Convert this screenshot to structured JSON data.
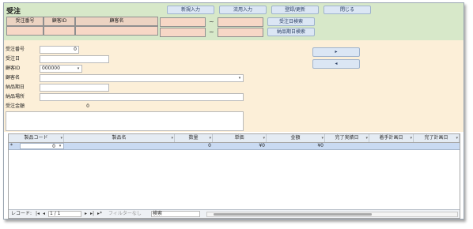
{
  "form": {
    "title": "受注"
  },
  "toolbar": {
    "new_label": "新規入力",
    "copy_label": "流用入力",
    "save_label": "登録/更新",
    "close_label": "閉じる"
  },
  "filter": {
    "headers": [
      "受注番号",
      "顧客ID",
      "顧客名"
    ],
    "tilde": "~",
    "order_date_search_label": "受注日検索",
    "delivery_date_search_label": "納品期日検索"
  },
  "fields": {
    "order_no": {
      "label": "受注番号",
      "value": "0"
    },
    "order_date": {
      "label": "受注日",
      "value": ""
    },
    "customer_id": {
      "label": "顧客ID",
      "value": "000000"
    },
    "customer_name": {
      "label": "顧客名",
      "value": ""
    },
    "delivery_due": {
      "label": "納品期日",
      "value": ""
    },
    "delivery_place": {
      "label": "納品場所",
      "value": ""
    },
    "order_amount": {
      "label": "受注金額",
      "value": "0"
    },
    "remarks": {
      "label": "備考",
      "value": ""
    }
  },
  "nav": {
    "next_label": "▸",
    "prev_label": "◂"
  },
  "subform": {
    "columns": [
      "製品コード",
      "製品名",
      "数量",
      "単価",
      "金額",
      "完了実績日",
      "着手計画日",
      "完了計画日"
    ],
    "row": {
      "marker": "*",
      "product_code": "0",
      "product_name": "",
      "quantity": "0",
      "unit_price": "¥0",
      "amount": "¥0"
    }
  },
  "statusbar": {
    "record_label": "レコード:",
    "first": "|◂",
    "prev": "◂",
    "position": "1 / 1",
    "next": "▸",
    "last": "▸|",
    "new": "▸*",
    "filter_label": "フィルターなし",
    "search_label": "検索"
  }
}
